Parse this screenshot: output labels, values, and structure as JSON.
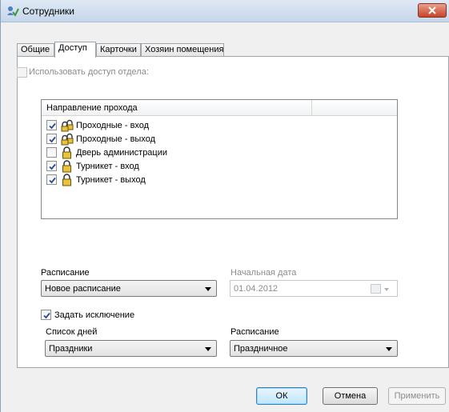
{
  "window": {
    "title": "Сотрудники"
  },
  "tabs": [
    {
      "label": "Общие"
    },
    {
      "label": "Доступ"
    },
    {
      "label": "Карточки"
    },
    {
      "label": "Хозяин помещения"
    }
  ],
  "access": {
    "use_dept_access_label": "Использовать доступ отдела:",
    "use_dept_access_checked": false,
    "passage_list": {
      "header": "Направление прохода",
      "items": [
        {
          "label": "Проходные - вход",
          "checked": true
        },
        {
          "label": "Проходные - выход",
          "checked": true
        },
        {
          "label": "Дверь администрации",
          "checked": false
        },
        {
          "label": "Турникет - вход",
          "checked": true
        },
        {
          "label": "Турникет - выход",
          "checked": true
        }
      ]
    },
    "schedule": {
      "label": "Расписание",
      "value": "Новое расписание"
    },
    "start_date": {
      "label": "Начальная дата",
      "value": "01.04.2012"
    },
    "exception": {
      "label": "Задать исключение",
      "checked": true,
      "day_list": {
        "label": "Список дней",
        "value": "Праздники"
      },
      "schedule": {
        "label": "Расписание",
        "value": "Праздничное"
      }
    }
  },
  "buttons": {
    "ok": "ОК",
    "cancel": "Отмена",
    "apply": "Применить"
  }
}
